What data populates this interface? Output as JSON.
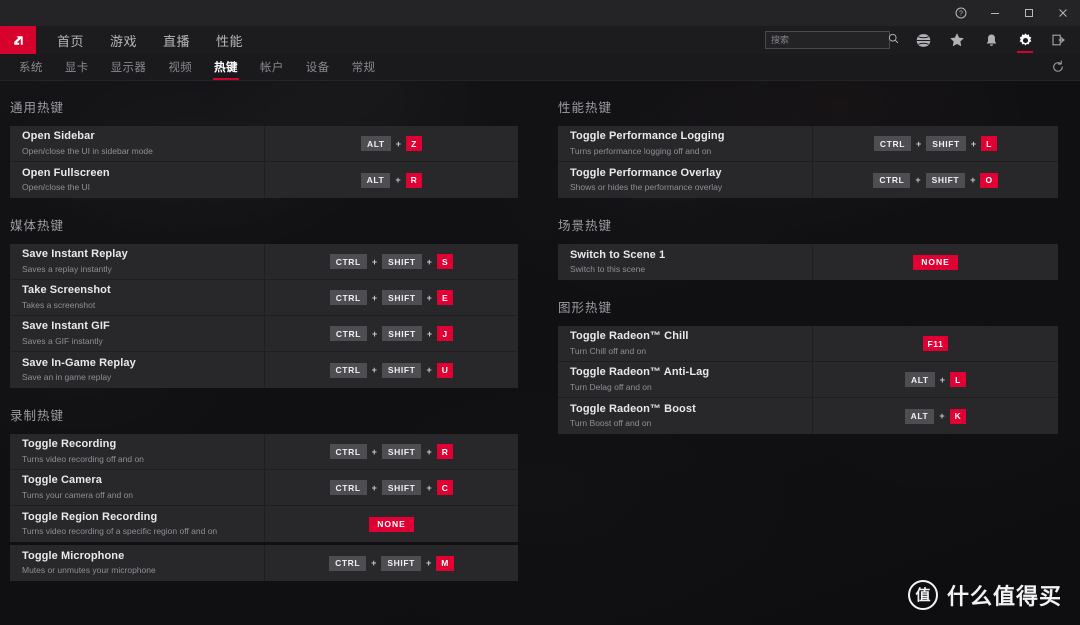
{
  "window": {
    "help_label": "?",
    "minimize_label": "—",
    "maximize_label": "□",
    "close_label": "×"
  },
  "mainnav": {
    "logo_alt": "AMD",
    "links": [
      {
        "label": "首页"
      },
      {
        "label": "游戏"
      },
      {
        "label": "直播"
      },
      {
        "label": "性能"
      }
    ],
    "search": {
      "placeholder": "搜索",
      "value": ""
    },
    "icons": [
      {
        "name": "globe-icon",
        "active": false
      },
      {
        "name": "star-icon",
        "active": false
      },
      {
        "name": "bell-icon",
        "active": false
      },
      {
        "name": "gear-icon",
        "active": true
      },
      {
        "name": "exit-icon",
        "active": false
      }
    ]
  },
  "subnav": {
    "items": [
      {
        "label": "系统",
        "active": false
      },
      {
        "label": "显卡",
        "active": false
      },
      {
        "label": "显示器",
        "active": false
      },
      {
        "label": "视频",
        "active": false
      },
      {
        "label": "热键",
        "active": true
      },
      {
        "label": "帐户",
        "active": false
      },
      {
        "label": "设备",
        "active": false
      },
      {
        "label": "常规",
        "active": false
      }
    ],
    "reset_icon": "reset-icon"
  },
  "colors": {
    "accent_red": "#e00034",
    "logo_red": "#d6012c",
    "key_gray": "#4d4d52",
    "card_bg": "#28282b",
    "page_bg": "#141416"
  },
  "left_column": [
    {
      "title": "通用热键",
      "rows": [
        {
          "name": "Open Sidebar",
          "desc": "Open/close the UI in sidebar mode",
          "keys": [
            {
              "text": "ALT",
              "style": "modifier"
            },
            {
              "text": "Z",
              "style": "accent"
            }
          ]
        },
        {
          "name": "Open Fullscreen",
          "desc": "Open/close the UI",
          "keys": [
            {
              "text": "ALT",
              "style": "modifier"
            },
            {
              "text": "R",
              "style": "accent"
            }
          ]
        }
      ]
    },
    {
      "title": "媒体热键",
      "rows": [
        {
          "name": "Save Instant Replay",
          "desc": "Saves a replay instantly",
          "keys": [
            {
              "text": "CTRL",
              "style": "modifier"
            },
            {
              "text": "SHIFT",
              "style": "modifier"
            },
            {
              "text": "S",
              "style": "accent"
            }
          ]
        },
        {
          "name": "Take Screenshot",
          "desc": "Takes a screenshot",
          "keys": [
            {
              "text": "CTRL",
              "style": "modifier"
            },
            {
              "text": "SHIFT",
              "style": "modifier"
            },
            {
              "text": "E",
              "style": "accent"
            }
          ]
        },
        {
          "name": "Save Instant GIF",
          "desc": "Saves a GIF instantly",
          "keys": [
            {
              "text": "CTRL",
              "style": "modifier"
            },
            {
              "text": "SHIFT",
              "style": "modifier"
            },
            {
              "text": "J",
              "style": "accent"
            }
          ]
        },
        {
          "name": "Save In-Game Replay",
          "desc": "Save an in game replay",
          "keys": [
            {
              "text": "CTRL",
              "style": "modifier"
            },
            {
              "text": "SHIFT",
              "style": "modifier"
            },
            {
              "text": "U",
              "style": "accent"
            }
          ]
        }
      ]
    },
    {
      "title": "录制热键",
      "rows": [
        {
          "name": "Toggle Recording",
          "desc": "Turns video recording off and on",
          "keys": [
            {
              "text": "CTRL",
              "style": "modifier"
            },
            {
              "text": "SHIFT",
              "style": "modifier"
            },
            {
              "text": "R",
              "style": "accent"
            }
          ]
        },
        {
          "name": "Toggle Camera",
          "desc": "Turns your camera off and on",
          "keys": [
            {
              "text": "CTRL",
              "style": "modifier"
            },
            {
              "text": "SHIFT",
              "style": "modifier"
            },
            {
              "text": "C",
              "style": "accent"
            }
          ]
        },
        {
          "name": "Toggle Region Recording",
          "desc": "Turns video recording of a specific region off and on",
          "keys": [
            {
              "text": "NONE",
              "style": "none"
            }
          ]
        }
      ]
    },
    {
      "title": "",
      "rows": [
        {
          "name": "Toggle Microphone",
          "desc": "Mutes or unmutes your microphone",
          "keys": [
            {
              "text": "CTRL",
              "style": "modifier"
            },
            {
              "text": "SHIFT",
              "style": "modifier"
            },
            {
              "text": "M",
              "style": "accent"
            }
          ]
        }
      ]
    }
  ],
  "right_column": [
    {
      "title": "性能热键",
      "rows": [
        {
          "name": "Toggle Performance Logging",
          "desc": "Turns performance logging off and on",
          "keys": [
            {
              "text": "CTRL",
              "style": "modifier"
            },
            {
              "text": "SHIFT",
              "style": "modifier"
            },
            {
              "text": "L",
              "style": "accent"
            }
          ]
        },
        {
          "name": "Toggle Performance Overlay",
          "desc": "Shows or hides the performance overlay",
          "keys": [
            {
              "text": "CTRL",
              "style": "modifier"
            },
            {
              "text": "SHIFT",
              "style": "modifier"
            },
            {
              "text": "O",
              "style": "accent"
            }
          ]
        }
      ]
    },
    {
      "title": "场景热键",
      "rows": [
        {
          "name": "Switch to Scene 1",
          "desc": "Switch to this scene",
          "keys": [
            {
              "text": "NONE",
              "style": "none"
            }
          ]
        }
      ]
    },
    {
      "title": "图形热键",
      "rows": [
        {
          "name": "Toggle Radeon™ Chill",
          "desc": "Turn Chill off and on",
          "keys": [
            {
              "text": "F11",
              "style": "accent"
            }
          ]
        },
        {
          "name": "Toggle Radeon™ Anti-Lag",
          "desc": "Turn Delag off and on",
          "keys": [
            {
              "text": "ALT",
              "style": "modifier"
            },
            {
              "text": "L",
              "style": "accent"
            }
          ]
        },
        {
          "name": "Toggle Radeon™ Boost",
          "desc": "Turn Boost off and on",
          "keys": [
            {
              "text": "ALT",
              "style": "modifier"
            },
            {
              "text": "K",
              "style": "accent"
            }
          ]
        }
      ]
    }
  ],
  "watermark": {
    "badge": "值",
    "text": "什么值得买"
  }
}
